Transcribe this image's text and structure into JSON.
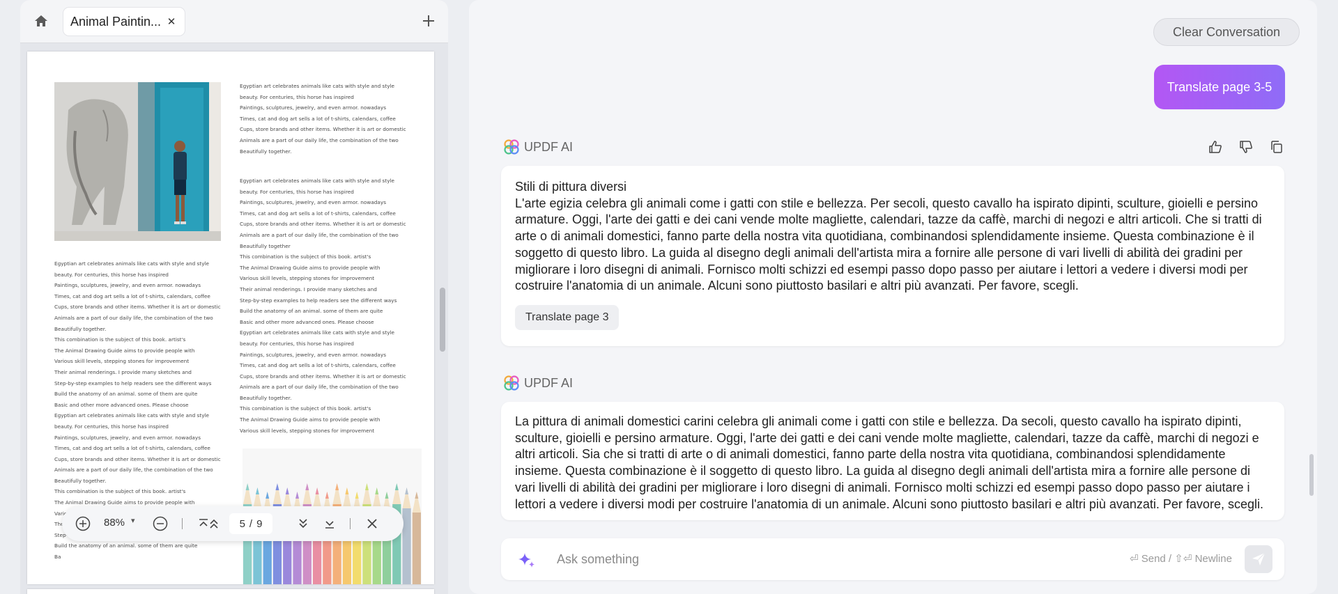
{
  "tabs": {
    "home_icon": "home-icon",
    "active_tab_label": "Animal Paintin...",
    "close_icon": "close-icon",
    "add_icon": "plus-icon"
  },
  "document": {
    "paragraph_a": "Egyptian art celebrates animals like cats with style and style\nbeauty. For centuries, this horse has inspired\nPaintings, sculptures, jewelry, and even armor. nowadays\nTimes, cat and dog art sells a lot of t-shirts, calendars, coffee\nCups, store brands and other items. Whether it is art or domestic\nAnimals are a part of our daily life, the combination of the two\nBeautifully together.",
    "paragraph_b": "Egyptian art celebrates animals like cats with style and style\nbeauty. For centuries, this horse has inspired\nPaintings, sculptures, jewelry, and even armor. nowadays\nTimes, cat and dog art sells a lot of t-shirts, calendars, coffee\nCups, store brands and other items. Whether it is art or domestic\nAnimals are a part of our daily life, the combination of the two\nBeautifully together\nThis combination is the subject of this book. artist's\nThe Animal Drawing Guide aims to provide people with\nVarious skill levels, stepping stones for improvement\nTheir animal renderings. I provide many sketches and\nStep-by-step examples to help readers see the different ways\nBuild the anatomy of an animal. some of them are quite\nBasic and other more advanced ones. Please choose\nEgyptian art celebrates animals like cats with style and style\nbeauty. For centuries, this horse has inspired\nPaintings, sculptures, jewelry, and even armor. nowadays\nTimes, cat and dog art sells a lot of t-shirts, calendars, coffee\nCups, store brands and other items. Whether it is art or domestic\nAnimals are a part of our daily life, the combination of the two\nBeautifully together.\nThis combination is the subject of this book. artist's\nThe Animal Drawing Guide aims to provide people with\nVarious skill levels, stepping stones for improvement",
    "paragraph_c": "Egyptian art celebrates animals like cats with style and style\nbeauty. For centuries, this horse has inspired\nPaintings, sculptures, jewelry, and even armor. nowadays\nTimes, cat and dog art sells a lot of t-shirts, calendars, coffee\nCups, store brands and other items. Whether it is art or domestic\nAnimals are a part of our daily life, the combination of the two\nBeautifully together.\nThis combination is the subject of this book. artist's\nThe Animal Drawing Guide aims to provide people with\nVarious skill levels, stepping stones for improvement\nTheir animal renderings. I provide many sketches and\nStep-by-step examples to help readers see the different ways\nBuild the anatomy of an animal. some of them are quite\nBasic and other more advanced ones. Please choose\nEgyptian art celebrates animals like cats with style and style\nbeauty. For centuries, this horse has inspired\nPaintings, sculptures, jewelry, and even armor. nowadays\nTimes, cat and dog art sells a lot of t-shirts, calendars, coffee\nCups, store brands and other items. Whether it is art or domestic\nAnimals are a part of our daily life, the combination of the two\nBeautifully together.\nThis combination is the subject of this book. artist's\nThe Animal Drawing Guide aims to provide people with\nVarious skill levels, stepping stones for improvement\nTheir animal renderings. I provide many sketches and\nStep-by-step examples to help readers see the different ways\nBuild the anatomy of an animal. some of them are quite\nBa"
  },
  "zoom_toolbar": {
    "zoom_value": "88%",
    "current_page": "5",
    "page_separator": "/",
    "total_pages": "9"
  },
  "chat": {
    "clear_label": "Clear Conversation",
    "user_message": "Translate page 3-5",
    "ai_name": "UPDF AI",
    "message1_title": "Stili di pittura diversi",
    "message1_body": "L'arte egizia celebra gli animali come i gatti con stile e bellezza. Per secoli, questo cavallo ha ispirato dipinti, sculture, gioielli e persino armature. Oggi, l'arte dei gatti e dei cani vende molte magliette, calendari, tazze da caffè, marchi di negozi e altri articoli. Che si tratti di arte o di animali domestici, fanno parte della nostra vita quotidiana, combinandosi splendidamente insieme. Questa combinazione è il soggetto di questo libro. La guida al disegno degli animali dell'artista mira a fornire alle persone di vari livelli di abilità dei gradini per migliorare i loro disegni di animali. Fornisco molti schizzi ed esempi passo dopo passo per aiutare i lettori a vedere i diversi modi per costruire l'anatomia di un animale. Alcuni sono piuttosto basilari e altri più avanzati. Per favore, scegli.",
    "message1_chip": "Translate page 3",
    "message2_body": "La pittura di animali domestici carini celebra gli animali come i gatti con stile e bellezza. Da secoli, questo cavallo ha ispirato dipinti, sculture, gioielli e persino armature. Oggi, l'arte dei gatti e dei cani vende molte magliette, calendari, tazze da caffè, marchi di negozi e altri articoli. Sia che si tratti di arte o di animali domestici, fanno parte della nostra vita quotidiana, combinandosi splendidamente insieme. Questa combinazione è il soggetto di questo libro. La guida al disegno degli animali dell'artista mira a fornire alle persone di vari livelli di abilità dei gradini per migliorare i loro disegni di animali. Fornisco molti schizzi ed esempi passo dopo passo per aiutare i lettori a vedere i diversi modi per costruire l'anatomia di un animale. Alcuni sono piuttosto basilari e altri più avanzati. Per favore, scegli.",
    "input_placeholder": "Ask something",
    "send_hint": "⏎ Send / ⇧⏎ Newline"
  },
  "colors": {
    "accent_gradient_start": "#b357f4",
    "accent_gradient_end": "#8f6cf7",
    "sparkle": "#7b61f8"
  }
}
